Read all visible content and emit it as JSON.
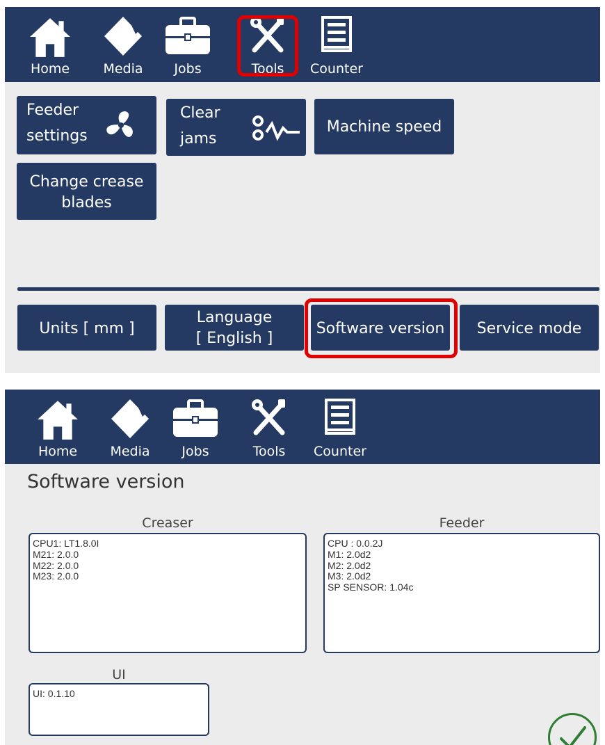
{
  "nav": {
    "home": "Home",
    "media": "Media",
    "jobs": "Jobs",
    "tools": "Tools",
    "counter": "Counter"
  },
  "tools_screen": {
    "feeder_settings": [
      "Feeder",
      "settings"
    ],
    "clear_jams": [
      "Clear",
      "jams"
    ],
    "machine_speed": "Machine speed",
    "change_crease_blades": [
      "Change crease",
      "blades"
    ],
    "units": "Units [ mm ]",
    "language": [
      "Language",
      "[ English ]"
    ],
    "software_version": "Software version",
    "service_mode": "Service mode"
  },
  "version_screen": {
    "title": "Software version",
    "creaser": {
      "label": "Creaser",
      "lines": [
        "CPU1: LT1.8.0I",
        "M21:  2.0.0",
        "M22:  2.0.0",
        "M23:  2.0.0"
      ]
    },
    "feeder": {
      "label": "Feeder",
      "lines": [
        "CPU : 0.0.2J",
        "M1:  2.0d2",
        "M2:  2.0d2",
        "M3:  2.0d2",
        "SP SENSOR:  1.04c"
      ]
    },
    "ui": {
      "label": "UI",
      "lines": [
        "UI: 0.1.10"
      ]
    }
  },
  "icons": {
    "home": "home-icon",
    "media": "media-icon",
    "jobs": "briefcase-icon",
    "tools": "tools-icon",
    "counter": "abacus-icon",
    "fan": "fan-icon",
    "jam": "jam-icon",
    "confirm": "checkmark-icon"
  },
  "colors": {
    "navy": "#243a63",
    "panel_bg": "#ececec",
    "highlight": "#e00000",
    "confirm": "#2e7d32"
  }
}
